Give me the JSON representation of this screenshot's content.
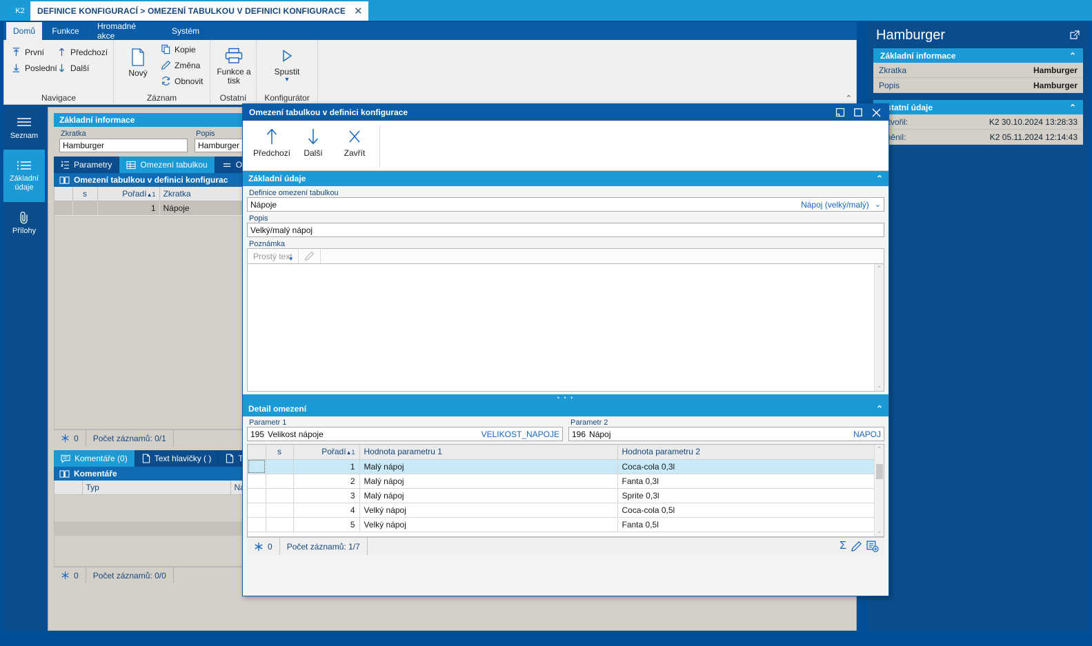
{
  "window": {
    "badge": "K2",
    "document_tab_title": "DEFINICE KONFIGURACÍ > OMEZENÍ TABULKOU V DEFINICI KONFIGURACE",
    "close_glyph": "✕"
  },
  "ribbon": {
    "tabs": [
      {
        "label": "Domů",
        "active": true
      },
      {
        "label": "Funkce",
        "active": false
      },
      {
        "label": "Hromadné akce",
        "active": false
      },
      {
        "label": "Systém",
        "active": false
      }
    ],
    "groups": [
      {
        "name": "Navigace",
        "buttons": [
          {
            "label": "První",
            "icon": "arrow-up-to-line-icon"
          },
          {
            "label": "Předchozí",
            "icon": "arrow-up-icon"
          },
          {
            "label": "Poslední",
            "icon": "arrow-down-to-line-icon"
          },
          {
            "label": "Další",
            "icon": "arrow-down-icon"
          }
        ]
      },
      {
        "name": "Záznam",
        "buttons": [
          {
            "label": "Nový",
            "icon": "document-icon"
          },
          {
            "label": "Kopie",
            "icon": "copy-icon"
          },
          {
            "label": "Změna",
            "icon": "pencil-icon"
          },
          {
            "label": "Obnovit",
            "icon": "refresh-icon"
          }
        ]
      },
      {
        "name": "Ostatní",
        "buttons": [
          {
            "label": "Funkce a tisk",
            "icon": "printer-icon"
          }
        ]
      },
      {
        "name": "Konfigurátor",
        "buttons": [
          {
            "label": "Spustit",
            "icon": "play-icon"
          }
        ]
      }
    ]
  },
  "sidebar": {
    "items": [
      {
        "label": "Seznam",
        "icon": "list-lines-icon",
        "active": false
      },
      {
        "label": "Základní údaje",
        "icon": "bullet-list-icon",
        "active": true
      },
      {
        "label": "Přílohy",
        "icon": "paperclip-icon",
        "active": false
      }
    ]
  },
  "main": {
    "basic_info": {
      "title": "Základní informace",
      "fields": [
        {
          "label": "Zkratka",
          "value": "Hamburger"
        },
        {
          "label": "Popis",
          "value": "Hamburger"
        }
      ]
    },
    "tabs": [
      {
        "label": "Parametry",
        "icon": "ordered-list-icon",
        "active": false
      },
      {
        "label": "Omezení tabulkou",
        "icon": "table-icon",
        "active": true
      },
      {
        "label": "Omeze",
        "icon": "equals-icon",
        "active": false
      }
    ],
    "grid": {
      "title": "Omezení tabulkou v definici konfigurac",
      "icon": "book-icon",
      "columns": [
        "",
        "s",
        "Pořadí",
        "Zkratka"
      ],
      "sort_column": "Pořadí",
      "sort_indicator": "▲",
      "sort_order": "1",
      "rows": [
        {
          "s": "",
          "poradi": "1",
          "zkratka": "Nápoje"
        }
      ],
      "status": {
        "freeze_count": "0",
        "text": "Počet záznamů: 0/1"
      }
    },
    "bottom_tabs": [
      {
        "label": "Komentáře (0)",
        "icon": "comment-icon",
        "active": true
      },
      {
        "label": "Text hlavičky ( )",
        "icon": "document-icon",
        "active": false
      },
      {
        "label": "Text",
        "icon": "document-icon",
        "active": false
      }
    ],
    "comments": {
      "title": "Komentáře",
      "icon": "book-icon",
      "columns": [
        "",
        "Typ",
        "Ná"
      ],
      "status": {
        "freeze_count": "0",
        "text": "Počet záznamů: 0/0"
      },
      "icons": [
        "sum-icon",
        "pencil-icon",
        "new-record-icon"
      ]
    }
  },
  "right_panel": {
    "title": "Hamburger",
    "popout_icon": "open-external-icon",
    "sections": [
      {
        "title": "Základní informace",
        "chevron": "⌃",
        "rows": [
          {
            "key": "Zkratka",
            "value": "Hamburger"
          },
          {
            "key": "Popis",
            "value": "Hamburger"
          }
        ]
      },
      {
        "title": "Ostatní údaje",
        "chevron": "⌃",
        "rows": [
          {
            "key": "Vytvořil:",
            "value": "K2 30.10.2024 13:28:33"
          },
          {
            "key": "Změnil:",
            "value": "K2 05.11.2024 12:14:43"
          }
        ]
      }
    ]
  },
  "modal": {
    "title": "Omezení tabulkou v definici konfigurace",
    "window_buttons": [
      {
        "name": "restore-down-icon",
        "glyph": "▣"
      },
      {
        "name": "maximize-icon",
        "glyph": "▢"
      },
      {
        "name": "close-icon",
        "glyph": "✕"
      }
    ],
    "toolbar": [
      {
        "label": "Předchozí",
        "icon": "arrow-up-icon",
        "glyph": "↑"
      },
      {
        "label": "Další",
        "icon": "arrow-down-icon",
        "glyph": "↓"
      },
      {
        "label": "Zavřít",
        "icon": "close-x-icon",
        "glyph": "✕"
      }
    ],
    "basic": {
      "title": "Základní údaje",
      "chevron": "⌃",
      "definition": {
        "label": "Definice omezení tabulkou",
        "value": "Nápoje",
        "right_value": "Nápoj (velký/malý)",
        "caret": "⌄"
      },
      "popis": {
        "label": "Popis",
        "value": "Velký/malý nápoj"
      },
      "poznamka": {
        "label": "Poznámka",
        "format_label": "Prostý text",
        "edit_icon": "pencil-icon",
        "value": ""
      }
    },
    "detail": {
      "title": "Detail omezení",
      "chevron": "⌃",
      "param1": {
        "label": "Parametr 1",
        "id": "195",
        "value": "Velikost nápoje",
        "code": "VELIKOST_NAPOJE"
      },
      "param2": {
        "label": "Parametr 2",
        "id": "196",
        "value": "Nápoj",
        "code": "NAPOJ"
      },
      "grid": {
        "columns": [
          "",
          "s",
          "Pořadí",
          "Hodnota parametru 1",
          "Hodnota parametru 2"
        ],
        "sort_column": "Pořadí",
        "sort_indicator": "▲",
        "sort_order": "1",
        "rows": [
          {
            "poradi": "1",
            "h1": "Malý nápoj",
            "h2": "Coca-cola 0,3l",
            "selected": true
          },
          {
            "poradi": "2",
            "h1": "Malý nápoj",
            "h2": "Fanta 0,3l",
            "selected": false
          },
          {
            "poradi": "3",
            "h1": "Malý nápoj",
            "h2": "Sprite 0,3l",
            "selected": false
          },
          {
            "poradi": "4",
            "h1": "Velký nápoj",
            "h2": "Coca-cola 0,5l",
            "selected": false
          },
          {
            "poradi": "5",
            "h1": "Velký nápoj",
            "h2": "Fanta 0,5l",
            "selected": false
          }
        ],
        "status": {
          "freeze_count": "0",
          "text": "Počet záznamů: 1/7"
        },
        "icons": [
          "sum-icon",
          "pencil-icon",
          "new-record-icon"
        ]
      }
    }
  },
  "colors": {
    "accent_blue": "#1a9ad7",
    "dark_blue": "#0b4d8c",
    "ribbon_blue": "#0b5ca8",
    "selection_blue": "#c8e9f7",
    "panel_gray": "#d4d0c8",
    "link_blue": "#1565c0"
  }
}
